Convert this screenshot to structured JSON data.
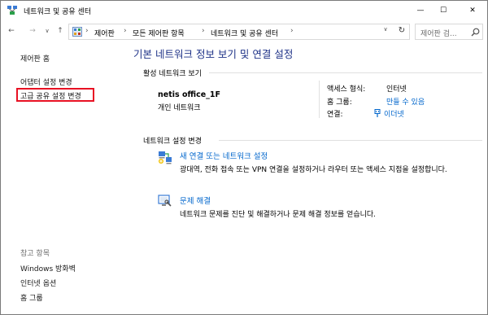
{
  "window": {
    "title": "네트워크 및 공유 센터",
    "minimize_glyph": "—",
    "maximize_glyph": "☐",
    "close_glyph": "✕"
  },
  "nav": {
    "back_glyph": "←",
    "forward_glyph": "→",
    "recent_glyph": "∨",
    "up_glyph": "↑",
    "refresh_glyph": "↻",
    "dropdown_glyph": "∨",
    "breadcrumbs": [
      "제어판",
      "모든 제어판 항목",
      "네트워크 및 공유 센터"
    ],
    "separator": "›",
    "search_placeholder": "제어판 검..."
  },
  "sidebar": {
    "items": [
      {
        "label": "제어판 홈"
      },
      {
        "label": "어댑터 설정 변경"
      },
      {
        "label": "고급 공유 설정 변경"
      }
    ],
    "see_also_title": "참고 항목",
    "see_also": [
      {
        "label": "Windows 방화벽"
      },
      {
        "label": "인터넷 옵션"
      },
      {
        "label": "홈 그룹"
      }
    ]
  },
  "main": {
    "title": "기본 네트워크 정보 보기 및 연결 설정",
    "active_section": "활성 네트워크 보기",
    "network": {
      "name": "netis office_1F",
      "type": "개인 네트워크"
    },
    "properties": [
      {
        "label": "액세스 형식:",
        "value": "인터넷",
        "is_link": false
      },
      {
        "label": "홈 그룹:",
        "value": "만들 수 있음",
        "is_link": true
      },
      {
        "label": "연결:",
        "value": "이더넷",
        "is_link": true
      }
    ],
    "change_section": "네트워크 설정 변경",
    "tasks": [
      {
        "link": "새 연결 또는 네트워크 설정",
        "description": "광대역, 전화 접속 또는 VPN 연결을 설정하거나 라우터 또는 액세스 지점을 설정합니다."
      },
      {
        "link": "문제 해결",
        "description": "네트워크 문제를 진단 및 해결하거나 문제 해결 정보를 얻습니다."
      }
    ]
  },
  "colors": {
    "link": "#0066cc",
    "title": "#1e3287",
    "highlight": "#e81123"
  }
}
